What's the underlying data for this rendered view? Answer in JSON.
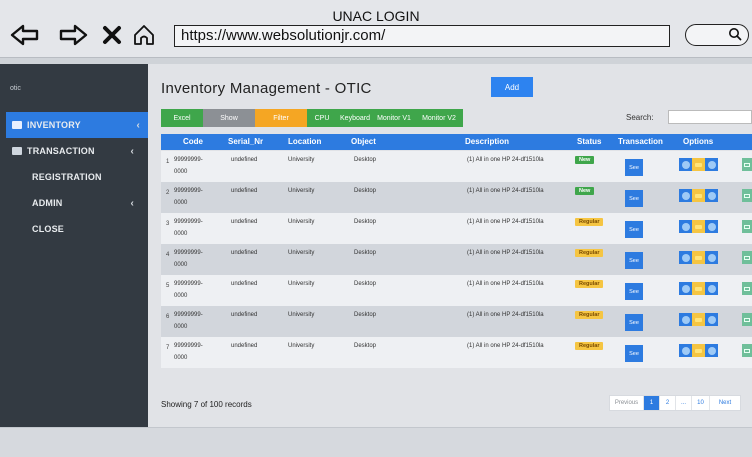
{
  "window": {
    "title": "UNAC LOGIN",
    "url": "https://www.websolutionjr.com/"
  },
  "sidebar": {
    "header": "otic",
    "items": [
      {
        "label": "INVENTORY",
        "active": true
      },
      {
        "label": "TRANSACTION",
        "active": false
      },
      {
        "label": "REGISTRATION",
        "active": false
      },
      {
        "label": "ADMIN",
        "active": false
      },
      {
        "label": "CLOSE",
        "active": false
      }
    ]
  },
  "main": {
    "title": "Inventory Management - OTIC",
    "add_label": "Add",
    "toolbar": [
      {
        "label": "Excel",
        "color": "#3fa64b"
      },
      {
        "label": "Show",
        "color": "#8c9095"
      },
      {
        "label": "Filter",
        "color": "#f5a623"
      },
      {
        "label": "CPU",
        "color": "#3fa64b"
      },
      {
        "label": "Keyboard",
        "color": "#3fa64b"
      },
      {
        "label": "Monitor V1",
        "color": "#3fa64b"
      },
      {
        "label": "Monitor V2",
        "color": "#3fa64b"
      }
    ],
    "search_label": "Search:",
    "columns": [
      "Code",
      "Serial_Nr",
      "Location",
      "Object",
      "Description",
      "Status",
      "Transaction",
      "Options"
    ],
    "rows": [
      {
        "num": "1",
        "code_a": "99999999-",
        "code_b": "0000",
        "serial": "undefined",
        "location": "University",
        "object": "Desktop",
        "description": "(1) All in one HP 24-df1510la",
        "status": "New",
        "transaction": "See"
      },
      {
        "num": "2",
        "code_a": "99999999-",
        "code_b": "0000",
        "serial": "undefined",
        "location": "University",
        "object": "Desktop",
        "description": "(1) All in one HP 24-df1510la",
        "status": "New",
        "transaction": "See"
      },
      {
        "num": "3",
        "code_a": "99999999-",
        "code_b": "0000",
        "serial": "undefined",
        "location": "University",
        "object": "Desktop",
        "description": "(1) All in one HP 24-df1510la",
        "status": "Regular",
        "transaction": "See"
      },
      {
        "num": "4",
        "code_a": "99999999-",
        "code_b": "0000",
        "serial": "undefined",
        "location": "University",
        "object": "Desktop",
        "description": "(1) All in one HP 24-df1510la",
        "status": "Regular",
        "transaction": "See"
      },
      {
        "num": "5",
        "code_a": "99999999-",
        "code_b": "0000",
        "serial": "undefined",
        "location": "University",
        "object": "Desktop",
        "description": "(1) All in one HP 24-df1510la",
        "status": "Regular",
        "transaction": "See"
      },
      {
        "num": "6",
        "code_a": "99999999-",
        "code_b": "0000",
        "serial": "undefined",
        "location": "University",
        "object": "Desktop",
        "description": "(1) All in one HP 24-df1510la",
        "status": "Regular",
        "transaction": "See"
      },
      {
        "num": "7",
        "code_a": "99999999-",
        "code_b": "0000",
        "serial": "undefined",
        "location": "University",
        "object": "Desktop",
        "description": "(1) All in one HP 24-df1510la",
        "status": "Regular",
        "transaction": "See"
      }
    ],
    "records_text": "Showing 7 of 100 records",
    "pagination": [
      "Previous",
      "1",
      "2",
      "...",
      "10",
      "Next"
    ]
  },
  "colors": {
    "accent": "#2d7be0",
    "sidebar": "#333a42",
    "status_new": "#3fa64b",
    "status_regular": "#f5c542"
  }
}
